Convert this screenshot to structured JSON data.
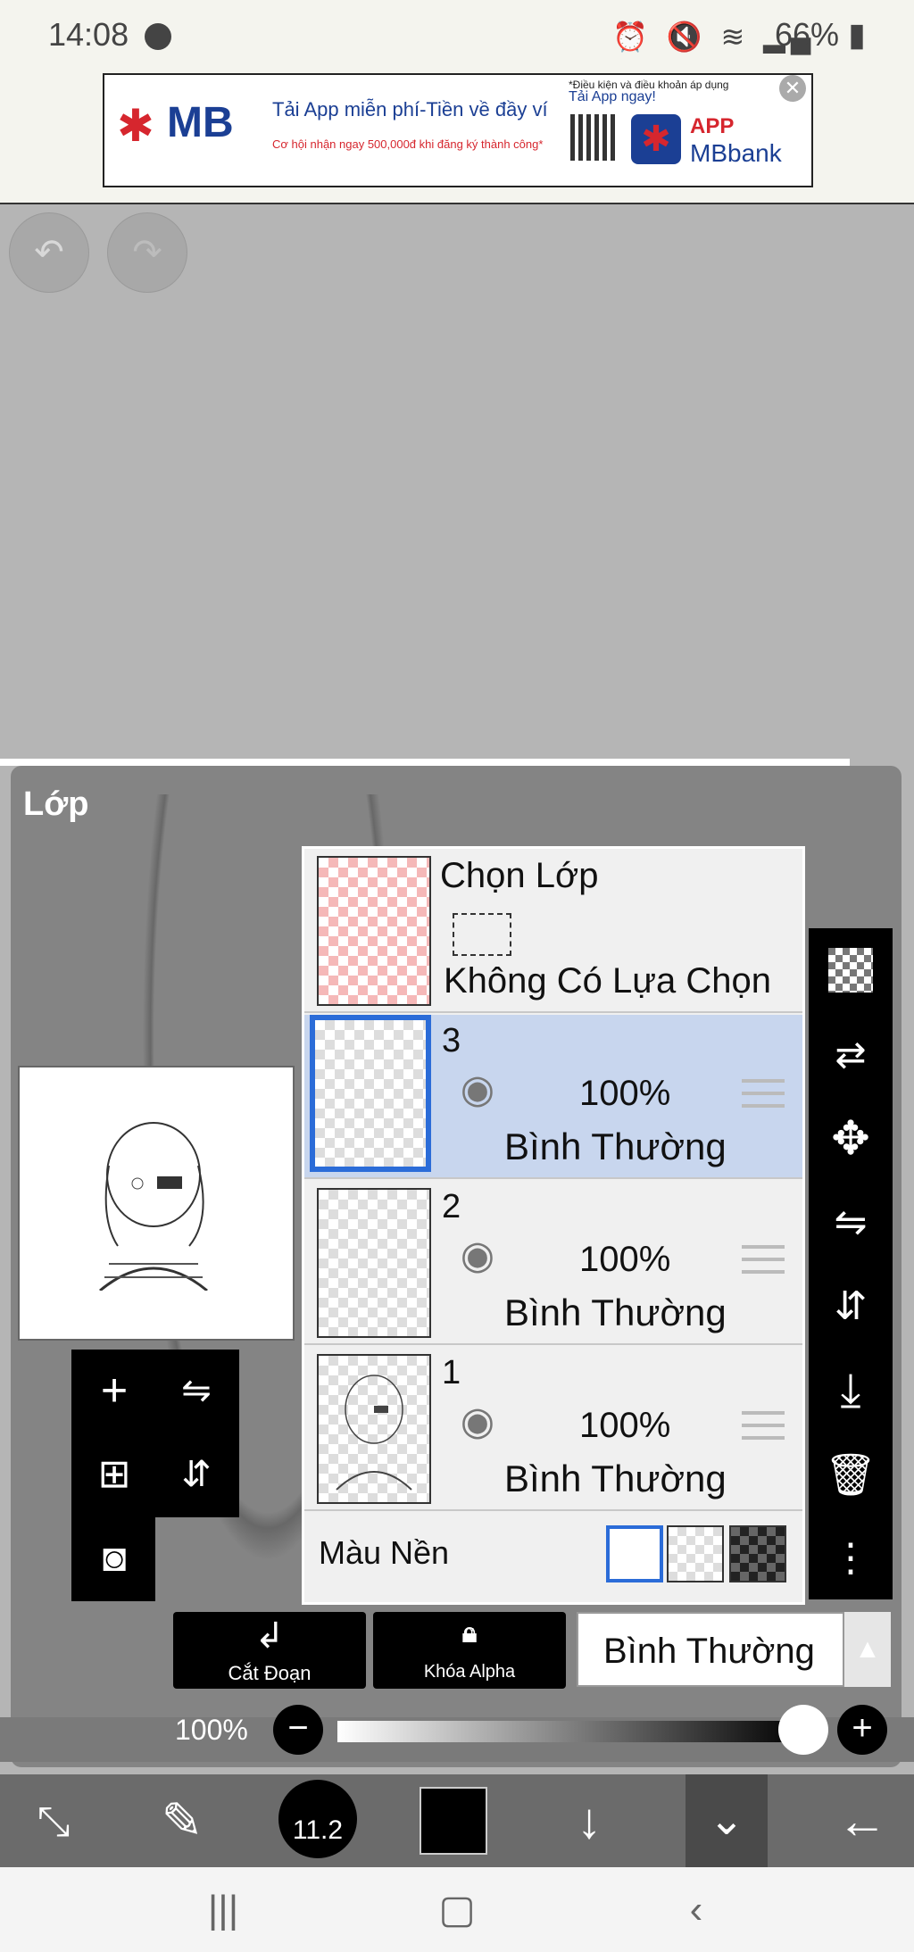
{
  "status_bar": {
    "time": "14:08",
    "status_icons": "⏰ 🔇 ≋ ▂▄",
    "battery": "66%"
  },
  "ad": {
    "brand": "MB",
    "headline": "Tải App miễn phí-Tiền về đầy ví",
    "subline": "Cơ hội nhận ngay 500,000đ khi đăng ký thành công*",
    "fine_print": "*Điều kiện và điều khoản áp dụng",
    "cta": "Tải App ngay!",
    "app_label": "APP",
    "bank_label": "MBbank"
  },
  "canvas": {
    "undo_icon": "undo-icon",
    "redo_icon": "redo-icon"
  },
  "panel": {
    "title": "Lớp"
  },
  "layers": {
    "selection": {
      "title": "Chọn Lớp",
      "subtitle": "Không Có Lựa Chọn"
    },
    "items": [
      {
        "number": "3",
        "opacity": "100%",
        "blend": "Bình Thường",
        "selected": true
      },
      {
        "number": "2",
        "opacity": "100%",
        "blend": "Bình Thường",
        "selected": false
      },
      {
        "number": "1",
        "opacity": "100%",
        "blend": "Bình Thường",
        "selected": false
      }
    ],
    "background": {
      "label": "Màu Nền"
    }
  },
  "actions": {
    "clip_label": "Cắt Đoạn",
    "alpha_lock_label": "Khóa Alpha",
    "alpha_glyph": "α",
    "blend_mode": "Bình Thường"
  },
  "opacity": {
    "label": "100%",
    "value": 1.0
  },
  "toolbar": {
    "brush_size": "11.2"
  },
  "colors": {
    "selected_blue": "#2b6cd8",
    "panel_gray": "#848484",
    "canvas_gray": "#b5b5b5",
    "mb_blue": "#1b3f94",
    "mb_red": "#d6262e"
  }
}
